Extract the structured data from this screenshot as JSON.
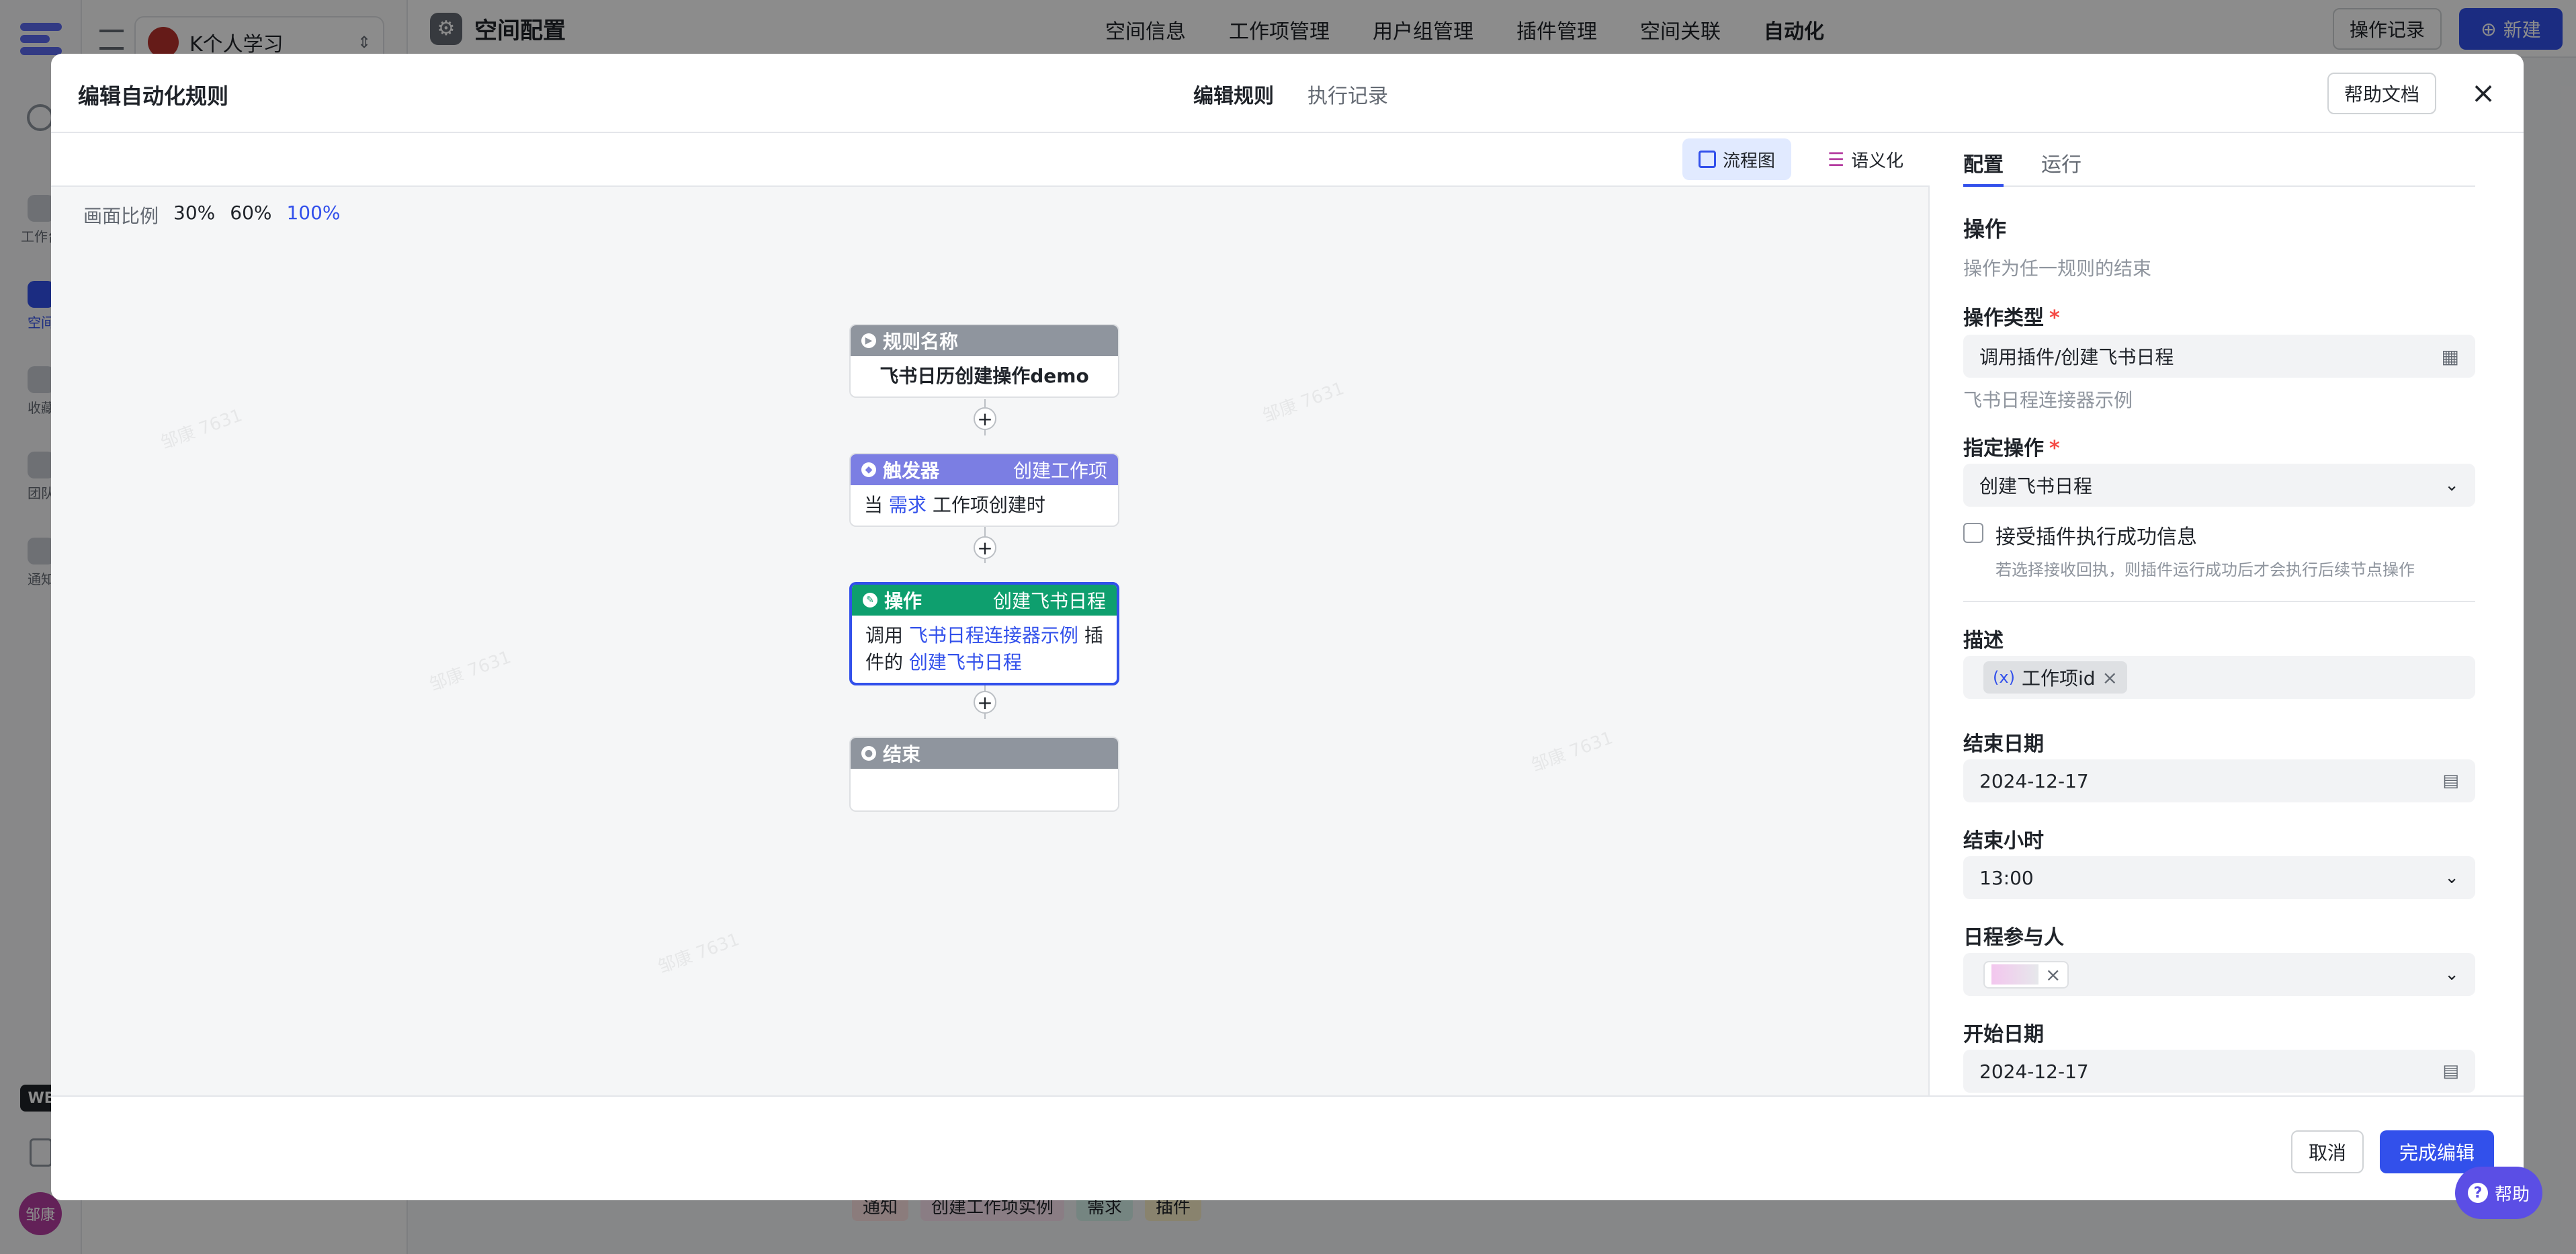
{
  "app": {
    "space_name": "K个人学习",
    "page_title": "空间配置",
    "nav": [
      "空间信息",
      "工作项管理",
      "用户组管理",
      "插件管理",
      "空间关联",
      "自动化"
    ],
    "operation_log": "操作记录",
    "new_button": "新建",
    "left_nav": [
      "工作台",
      "空间",
      "收藏",
      "团队",
      "通知"
    ],
    "workspace_badge": "WB",
    "user_avatar": "邹康",
    "bottom_tags": [
      "通知",
      "创建工作项实例",
      "需求",
      "插件"
    ]
  },
  "modal": {
    "title": "编辑自动化规则",
    "tabs": [
      "编辑规则",
      "执行记录"
    ],
    "help_doc": "帮助文档",
    "view_toggle": {
      "flow": "流程图",
      "semantic": "语义化"
    },
    "zoom": {
      "label": "画面比例",
      "options": [
        "30%",
        "60%",
        "100%"
      ],
      "selected": "100%"
    },
    "flow": {
      "rule": {
        "header": "规则名称",
        "body": "飞书日历创建操作demo"
      },
      "trigger": {
        "header": "触发器",
        "tag": "创建工作项",
        "pre": "当",
        "entity": "需求",
        "post": "工作项创建时"
      },
      "action": {
        "header": "操作",
        "tag": "创建飞书日程",
        "pre": "调用",
        "plugin": "飞书日程连接器示例",
        "mid": "插件的",
        "op": "创建飞书日程"
      },
      "end": {
        "header": "结束"
      },
      "plus": "+"
    },
    "panel": {
      "tabs": [
        "配置",
        "运行"
      ],
      "section_title": "操作",
      "section_desc": "操作为任一规则的结束",
      "op_type_label": "操作类型",
      "op_type_value": "调用插件/创建飞书日程",
      "op_type_hint": "飞书日程连接器示例",
      "specified_op_label": "指定操作",
      "specified_op_value": "创建飞书日程",
      "accept_label": "接受插件执行成功信息",
      "accept_hint": "若选择接收回执，则插件运行成功后才会执行后续节点操作",
      "desc_label": "描述",
      "desc_chip_prefix": "(x)",
      "desc_chip": "工作项id",
      "end_date_label": "结束日期",
      "end_date_value": "2024-12-17",
      "end_hour_label": "结束小时",
      "end_hour_value": "13:00",
      "participants_label": "日程参与人",
      "start_date_label": "开始日期",
      "start_date_value": "2024-12-17"
    },
    "footer": {
      "cancel": "取消",
      "done": "完成编辑"
    }
  },
  "help_fab": "帮助",
  "watermark": "邹康 7631",
  "colors": {
    "primary": "#3250eb",
    "trigger": "#7b7ee3",
    "action": "#0e9f6e",
    "rule": "#8f959e",
    "required": "#f54a45"
  }
}
